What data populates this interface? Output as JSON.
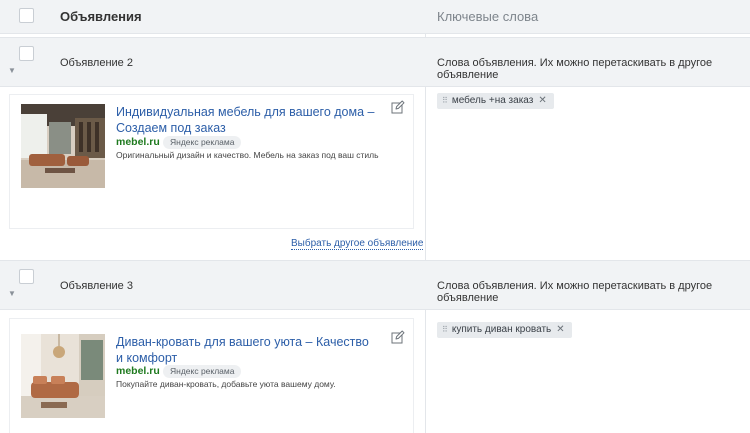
{
  "header": {
    "title": "Объявления",
    "keywords_title": "Ключевые слова"
  },
  "groups": [
    {
      "label": "Объявление 2",
      "hint": "Слова объявления. Их можно перетаскивать в другое объявление",
      "ad": {
        "title": "Индивидуальная мебель для вашего дома – Создаем под заказ",
        "domain": "mebel.ru",
        "badge": "Яндекс реклама",
        "text": "Оригинальный дизайн и качество. Мебель на заказ под ваш стиль"
      },
      "choose_link": "Выбрать другое объявление",
      "keywords": [
        {
          "text": "мебель +на заказ"
        }
      ]
    },
    {
      "label": "Объявление 3",
      "hint": "Слова объявления. Их можно перетаскивать в другое объявление",
      "ad": {
        "title": "Диван-кровать для вашего уюта – Качество и комфорт",
        "domain": "mebel.ru",
        "badge": "Яндекс реклама",
        "text": "Покупайте диван-кровать, добавьте уюта вашему дому."
      },
      "keywords": [
        {
          "text": "купить диван кровать"
        }
      ]
    }
  ],
  "icons": {
    "grip": "⠿",
    "remove": "✕",
    "caret": "▼"
  }
}
